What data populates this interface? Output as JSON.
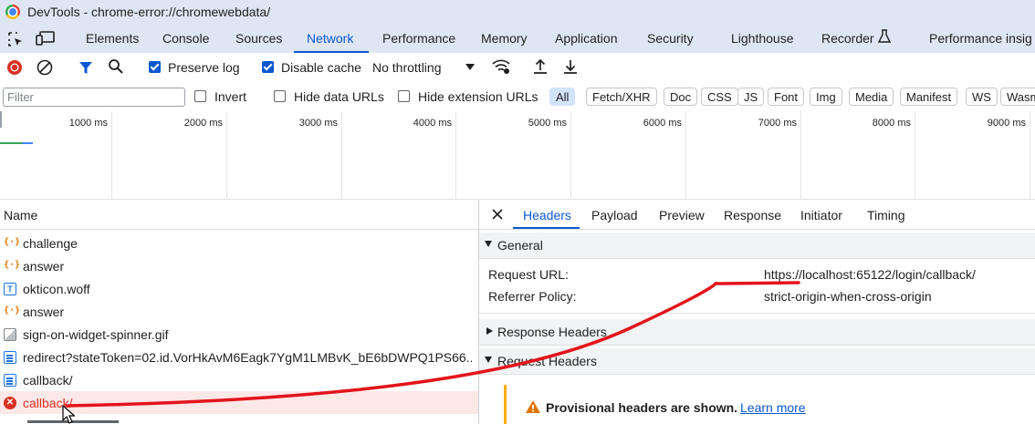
{
  "window": {
    "title": "DevTools - chrome-error://chromewebdata/"
  },
  "panel_tabs": [
    "Elements",
    "Console",
    "Sources",
    "Network",
    "Performance",
    "Memory",
    "Application",
    "Security",
    "Lighthouse",
    "Recorder",
    "Performance insig"
  ],
  "active_panel_tab": "Network",
  "toolbar": {
    "preserve_log": "Preserve log",
    "preserve_log_checked": true,
    "disable_cache": "Disable cache",
    "disable_cache_checked": true,
    "throttling": "No throttling"
  },
  "filter": {
    "placeholder": "Filter",
    "invert": "Invert",
    "hide_data_urls": "Hide data URLs",
    "hide_extension_urls": "Hide extension URLs",
    "types": [
      "All",
      "Fetch/XHR",
      "Doc",
      "CSS",
      "JS",
      "Font",
      "Img",
      "Media",
      "Manifest",
      "WS",
      "Wasm"
    ],
    "selected_type": "All"
  },
  "timeline": {
    "ticks": [
      "1000 ms",
      "2000 ms",
      "3000 ms",
      "4000 ms",
      "5000 ms",
      "6000 ms",
      "7000 ms",
      "8000 ms",
      "9000 ms"
    ]
  },
  "requests": {
    "column_name": "Name",
    "rows": [
      {
        "name": "challenge",
        "icon": "xhr-icon"
      },
      {
        "name": "answer",
        "icon": "xhr-icon"
      },
      {
        "name": "okticon.woff",
        "icon": "font-icon"
      },
      {
        "name": "answer",
        "icon": "xhr-icon"
      },
      {
        "name": "sign-on-widget-spinner.gif",
        "icon": "image-icon"
      },
      {
        "name": "redirect?stateToken=02.id.VorHkAvM6Eagk7YgM1LMBvK_bE6bDWPQ1PS66...",
        "icon": "document-icon"
      },
      {
        "name": "callback/",
        "icon": "document-icon"
      },
      {
        "name": "callback/",
        "icon": "error-icon",
        "status": "error"
      }
    ]
  },
  "details": {
    "tabs": [
      "Headers",
      "Payload",
      "Preview",
      "Response",
      "Initiator",
      "Timing"
    ],
    "active_tab": "Headers",
    "general": {
      "title": "General",
      "request_url_label": "Request URL:",
      "request_url": "https://localhost:65122/login/callback/",
      "referrer_policy_label": "Referrer Policy:",
      "referrer_policy": "strict-origin-when-cross-origin"
    },
    "response_headers_title": "Response Headers",
    "request_headers_title": "Request Headers",
    "provisional_warning": "Provisional headers are shown.",
    "learn_more": "Learn more"
  },
  "colors": {
    "accent": "#0b57d0",
    "error": "#d93025",
    "annotation": "#e3141b",
    "selected_row": "#fce8e6"
  }
}
